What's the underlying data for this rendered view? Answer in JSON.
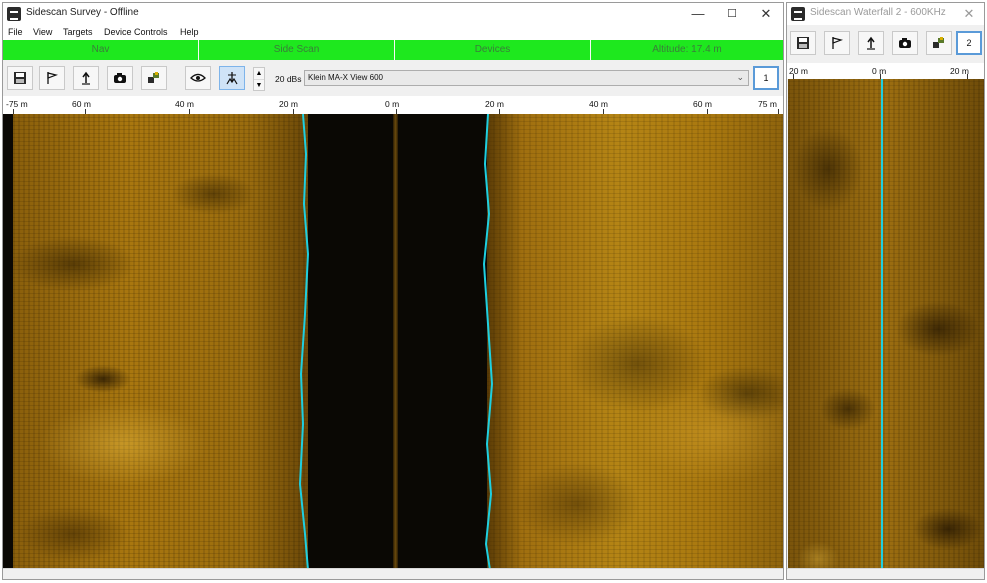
{
  "colors": {
    "nav_green": "#1ee81e",
    "nav_text": "#3b7d3b",
    "bottom_track": "#1ecfe0",
    "sonar_gold": "#a9770f"
  },
  "main_window": {
    "title": "Sidescan Survey - Offline",
    "controls": {
      "minimize": "—",
      "maximize": "☐",
      "close": "✕"
    },
    "menu": [
      "File",
      "View",
      "Targets",
      "Device Controls",
      "Help"
    ],
    "status_tabs": [
      "Nav",
      "Side Scan",
      "Devices",
      "Altitude: 17.4 m"
    ],
    "toolbar": {
      "icons": [
        "save-icon",
        "flag-icon",
        "upload-arrow-icon",
        "camera-icon",
        "target-icon",
        "eye-icon",
        "waterfall-icon"
      ],
      "gain_value": "20 dBs",
      "device_selected": "Klein MA-X View 600",
      "channel_button": "1"
    },
    "scale_labels": [
      "-75 m",
      "60 m",
      "40 m",
      "20 m",
      "0 m",
      "20 m",
      "40 m",
      "60 m",
      "75 m"
    ]
  },
  "side_window": {
    "title": "Sidescan Waterfall 2 - 600KHz",
    "close": "✕",
    "toolbar": {
      "icons": [
        "save-icon",
        "flag-icon",
        "upload-arrow-icon",
        "camera-icon",
        "target-icon"
      ],
      "channel_button": "2"
    },
    "scale_labels": [
      "20 m",
      "0 m",
      "20 m"
    ]
  }
}
